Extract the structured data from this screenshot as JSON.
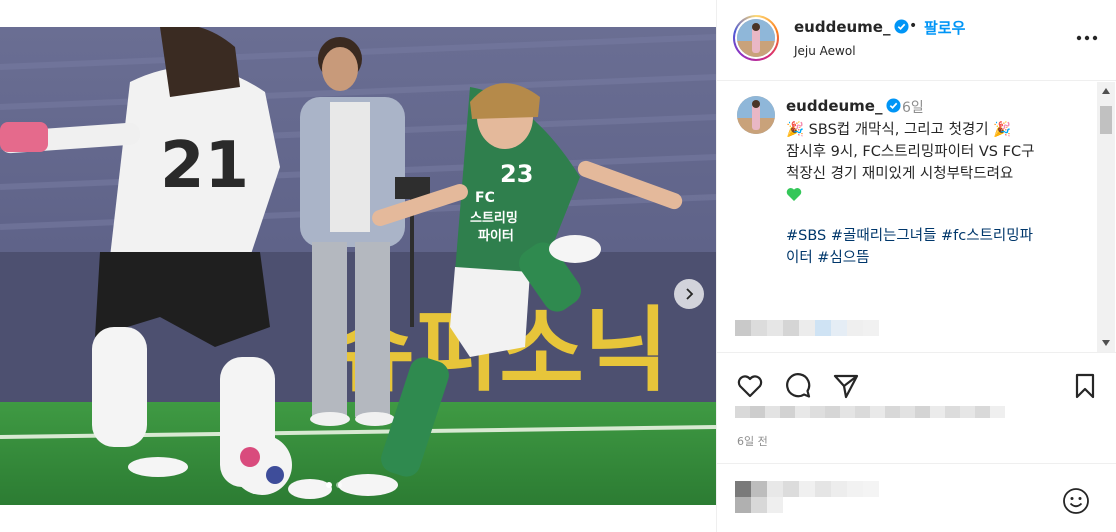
{
  "post": {
    "username": "euddeume_",
    "separator": "•",
    "follow_label": "팔로우",
    "location": "Jeju Aewol",
    "caption_time": "6일",
    "caption_lines": [
      "SBS컵 개막식, 그리고 첫경기",
      "잠시후 9시, FC스트리밍파이터 VS FC구",
      "척장신 경기 재미있게 시청부탁드려요"
    ],
    "hashtags": [
      "#SBS",
      "#골때리는그녀들",
      "#fc스트리밍파",
      "이터",
      "#심으뜸"
    ],
    "post_time": "6일 전",
    "accent_color": "#0095f6"
  },
  "photo": {
    "banner_text": "슈퍼소닉",
    "jersey_left": "21",
    "jersey_right": "23",
    "jersey_right_text": "FC 스트리밍 파이터",
    "carousel_dots": 2
  },
  "icons": {
    "more": "more-horizontal-icon",
    "like": "heart-icon",
    "comment": "comment-icon",
    "share": "paper-plane-icon",
    "save": "bookmark-icon",
    "emoji": "smiley-icon",
    "next": "chevron-right-icon",
    "verified": "verified-badge-icon"
  }
}
